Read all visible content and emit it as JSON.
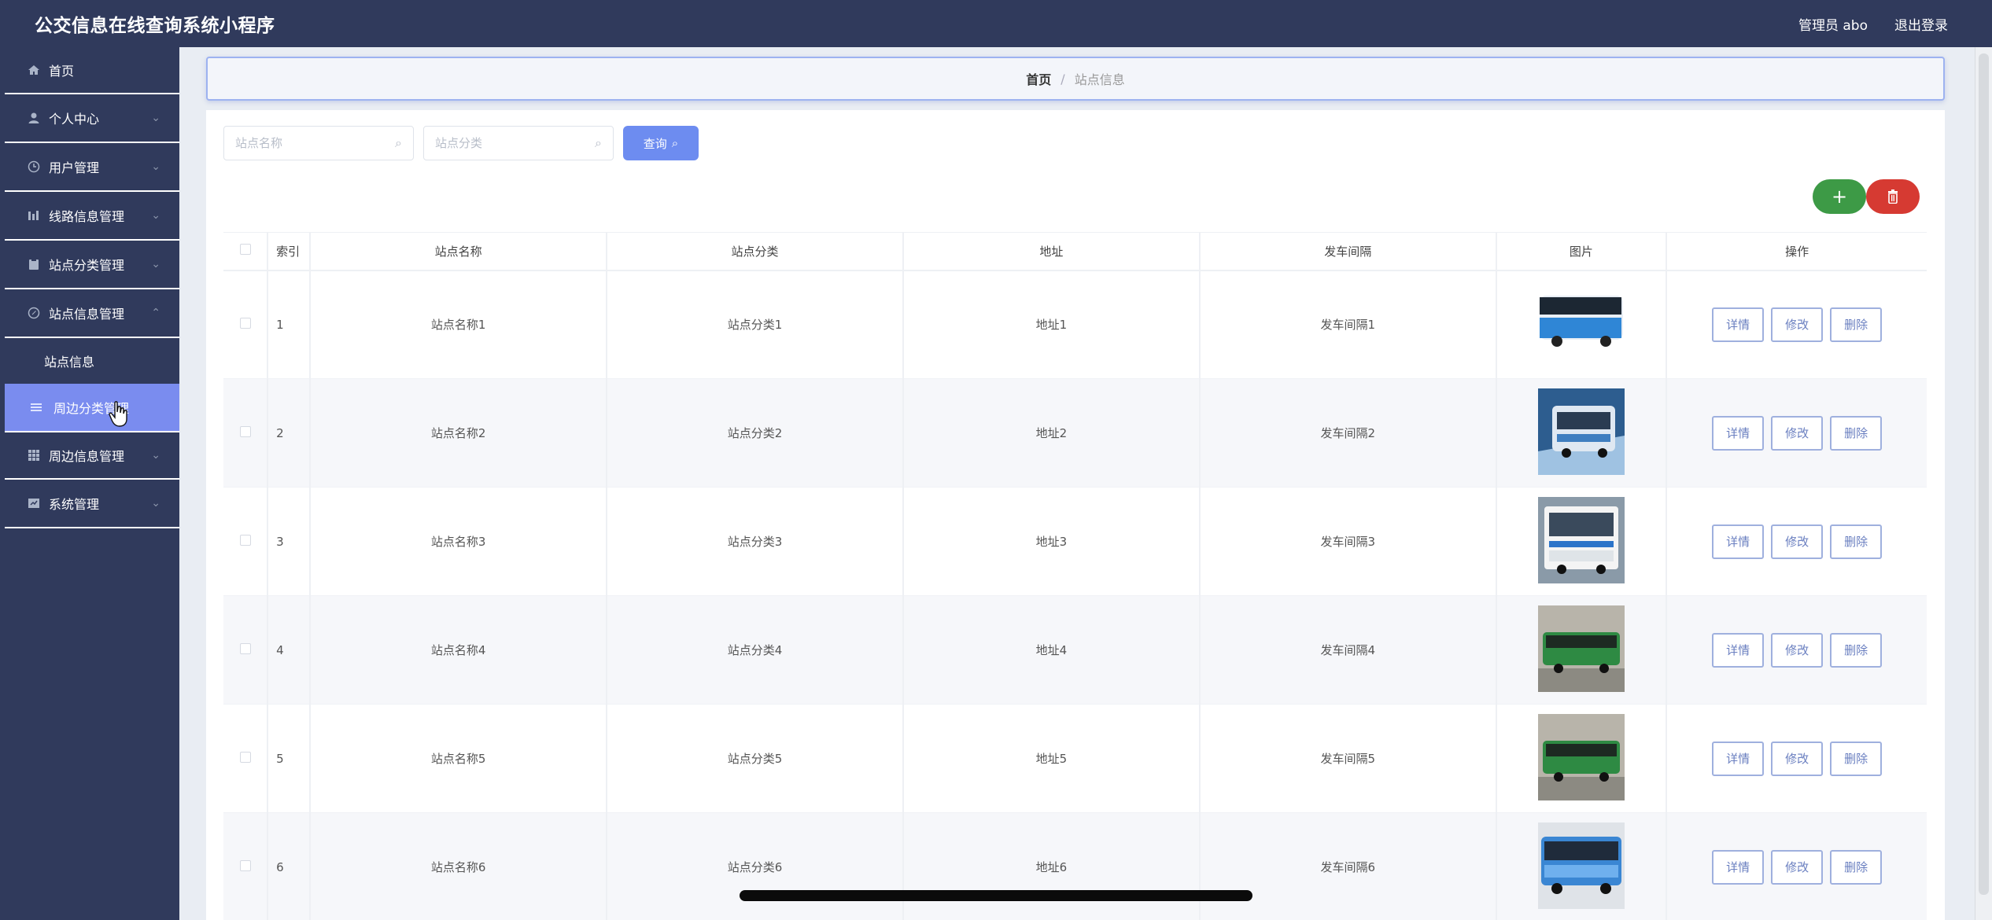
{
  "header": {
    "app_title": "公交信息在线查询系统小程序",
    "admin_label": "管理员 abo",
    "logout_label": "退出登录"
  },
  "sidebar": {
    "items": [
      {
        "label": "首页",
        "icon": "home-icon"
      },
      {
        "label": "个人中心",
        "icon": "user-icon"
      },
      {
        "label": "用户管理",
        "icon": "clock-icon"
      },
      {
        "label": "线路信息管理",
        "icon": "bar-icon"
      },
      {
        "label": "站点分类管理",
        "icon": "clipboard-icon"
      },
      {
        "label": "站点信息管理",
        "icon": "compass-icon"
      }
    ],
    "sub_items": [
      {
        "label": "站点信息"
      },
      {
        "label": "周边分类管理"
      }
    ],
    "items_after": [
      {
        "label": "周边信息管理",
        "icon": "grid-icon"
      },
      {
        "label": "系统管理",
        "icon": "window-icon"
      }
    ]
  },
  "breadcrumb": {
    "home": "首页",
    "separator": "/",
    "current": "站点信息"
  },
  "search": {
    "name_placeholder": "站点名称",
    "category_placeholder": "站点分类",
    "query_label": "查询"
  },
  "toolbar": {
    "add_symbol": "+",
    "delete_icon": "trash-icon"
  },
  "table": {
    "headers": [
      "索引",
      "站点名称",
      "站点分类",
      "地址",
      "发车间隔",
      "图片",
      "操作"
    ],
    "rows": [
      {
        "index": "1",
        "name": "站点名称1",
        "category": "站点分类1",
        "address": "地址1",
        "interval": "发车间隔1"
      },
      {
        "index": "2",
        "name": "站点名称2",
        "category": "站点分类2",
        "address": "地址2",
        "interval": "发车间隔2"
      },
      {
        "index": "3",
        "name": "站点名称3",
        "category": "站点分类3",
        "address": "地址3",
        "interval": "发车间隔3"
      },
      {
        "index": "4",
        "name": "站点名称4",
        "category": "站点分类4",
        "address": "地址4",
        "interval": "发车间隔4"
      },
      {
        "index": "5",
        "name": "站点名称5",
        "category": "站点分类5",
        "address": "地址5",
        "interval": "发车间隔5"
      },
      {
        "index": "6",
        "name": "站点名称6",
        "category": "站点分类6",
        "address": "地址6",
        "interval": "发车间隔6"
      }
    ],
    "actions": {
      "detail": "详情",
      "edit": "修改",
      "delete": "删除"
    }
  },
  "colors": {
    "sidebar_bg": "#303a5c",
    "active_menu": "#7a8cef",
    "query_button": "#6d8cf0",
    "add_button": "#3d9a46",
    "delete_button": "#d63a32"
  }
}
